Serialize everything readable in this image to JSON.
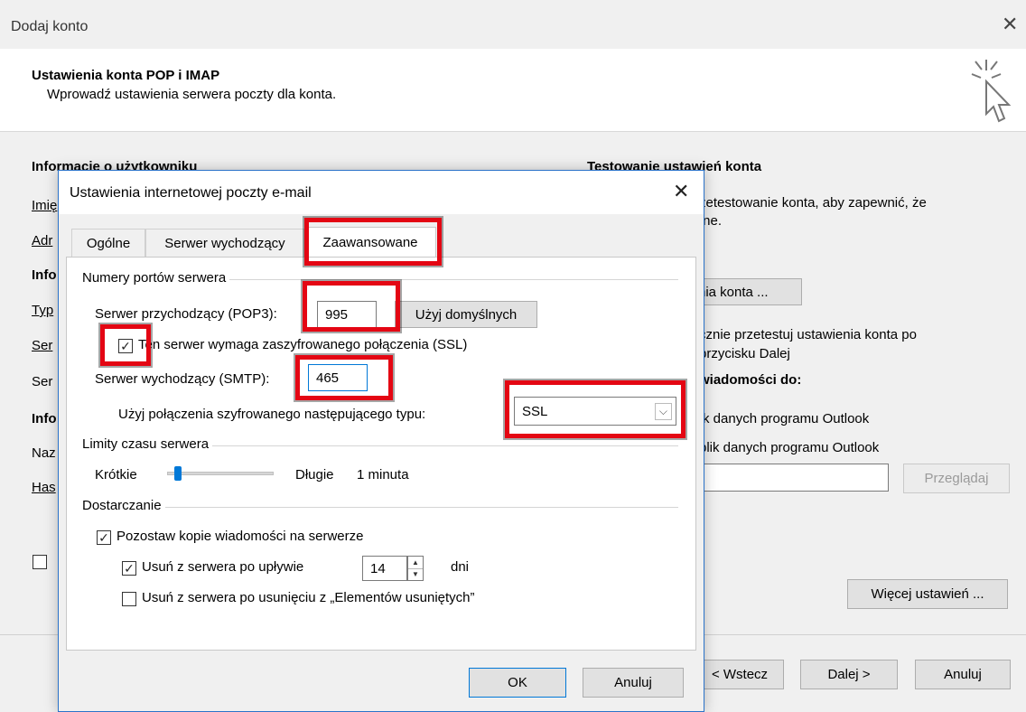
{
  "outer": {
    "title": "Dodaj konto",
    "heading": "Ustawienia konta POP i IMAP",
    "subheading": "Wprowadź ustawienia serwera poczty dla konta.",
    "left_fragments": [
      "Informacje o użytkowniku",
      "Imię",
      "Adr",
      "Info",
      "Typ",
      "Ser",
      "Ser",
      "Info",
      "Naz",
      "Has"
    ],
    "right": {
      "test_heading": "Testowanie ustawień konta",
      "test_text1": "zetestowanie konta, aby zapewnić, że",
      "test_text2": "ıne.",
      "test_button": "nia konta ...",
      "auto_test1": "cznie przetestuj ustawienia konta po",
      "auto_test2": "przycisku Dalej",
      "deliver_heading": "wiadomości do:",
      "option1": "k danych programu Outlook",
      "option2": "plik danych programu Outlook",
      "browse_button": "Przeglądaj",
      "more_settings_button": "Więcej ustawień ..."
    },
    "footer": {
      "back_button": "< Wstecz",
      "next_button": "Dalej >",
      "cancel_button": "Anuluj"
    }
  },
  "modal": {
    "title": "Ustawienia internetowej poczty e-mail",
    "tabs": [
      "Ogólne",
      "Serwer wychodzący",
      "Zaawansowane"
    ],
    "active_tab": "Zaawansowane",
    "ports_group": "Numery portów serwera",
    "incoming_label": "Serwer przychodzący (POP3):",
    "incoming_value": "995",
    "default_button": "Użyj domyślnych",
    "ssl_checkbox_label": "Ten serwer wymaga zaszyfrowanego połączenia (SSL)",
    "ssl_checked": true,
    "outgoing_label": "Serwer wychodzący (SMTP):",
    "outgoing_value": "465",
    "encryption_label": "Użyj połączenia szyfrowanego następującego typu:",
    "encryption_value": "SSL",
    "timeouts_group": "Limity czasu serwera",
    "timeout_short": "Krótkie",
    "timeout_long": "Długie",
    "timeout_value": "1 minuta",
    "timeout_level": 0.1,
    "delivery_group": "Dostarczanie",
    "leave_copy_label": "Pozostaw kopie wiadomości na serwerze",
    "leave_copy_checked": true,
    "remove_after_label": "Usuń z serwera po upływie",
    "remove_after_checked": true,
    "remove_after_days": "14",
    "days_unit": "dni",
    "remove_deleted_label": "Usuń z serwera po usunięciu z „Elementów usuniętych”",
    "remove_deleted_checked": false,
    "ok_button": "OK",
    "cancel_button": "Anuluj"
  },
  "colors": {
    "highlight": "#e40613",
    "accent": "#0078d7"
  }
}
